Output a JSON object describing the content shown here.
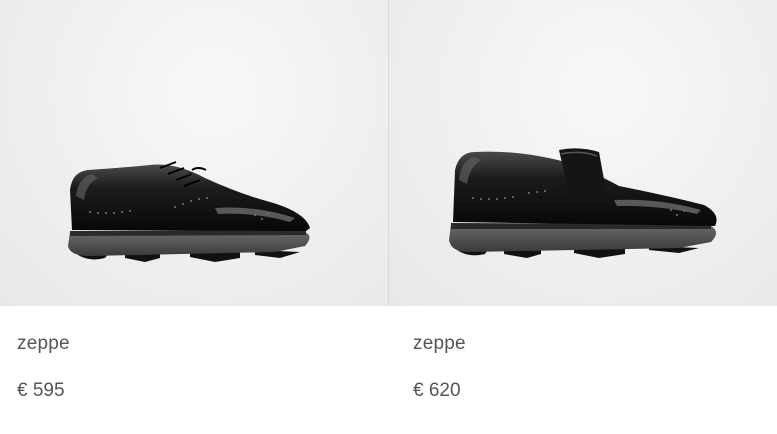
{
  "products": [
    {
      "name": "zeppe",
      "price": "€ 595",
      "image": "black-brogue-lace-up-golf-shoe"
    },
    {
      "name": "zeppe",
      "price": "€ 620",
      "image": "black-brogue-strap-golf-shoe"
    }
  ],
  "colors": {
    "background": "#ffffff",
    "image_bg": "#efefef",
    "text": "#555555",
    "divider": "#d9d9d9"
  }
}
